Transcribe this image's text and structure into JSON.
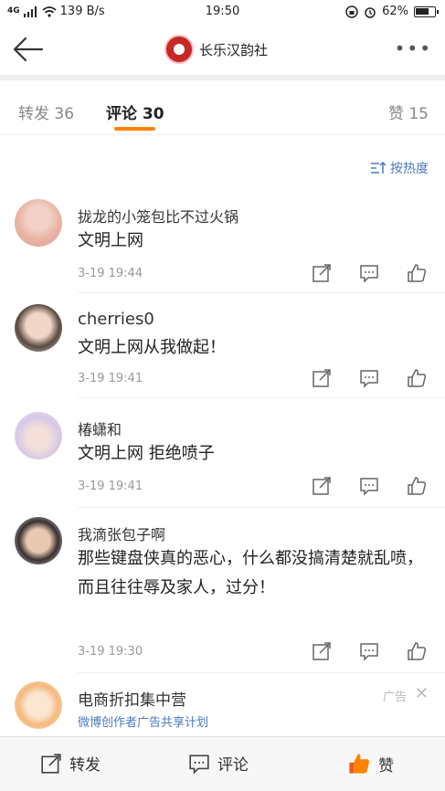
{
  "status_bar": {
    "signal": "4G",
    "speed": "139 B/s",
    "time": "19:50",
    "battery": "62%"
  },
  "nav": {
    "title": "长乐汉韵社"
  },
  "tabs": [
    {
      "label": "转发",
      "count": "36"
    },
    {
      "label": "评论",
      "count": "30"
    },
    {
      "label": "赞",
      "count": "15"
    }
  ],
  "sort": {
    "label": "按热度"
  },
  "comments": [
    {
      "user": "拢龙的小笼包比不过火锅",
      "text": "文明上网",
      "time": "3-19 19:44"
    },
    {
      "user": "cherries0",
      "text": "文明上网从我做起！",
      "time": "3-19 19:41"
    },
    {
      "user": "椿蟏和",
      "text": "文明上网 拒绝喷子",
      "time": "3-19 19:41"
    },
    {
      "user": "我滴张包子啊",
      "text": "那些键盘侠真的恶心，什么都没搞清楚就乱喷，而且往往辱及家人，过分！",
      "time": "3-19 19:30"
    }
  ],
  "ad": {
    "name": "电商折扣集中营",
    "sub": "微博创作者广告共享计划",
    "label": "广告"
  },
  "bottom": {
    "repost": "转发",
    "comment": "评论",
    "like": "赞"
  },
  "colors": {
    "accent": "#ff8200",
    "link": "#4a7bc0",
    "like": "#ff8200"
  }
}
